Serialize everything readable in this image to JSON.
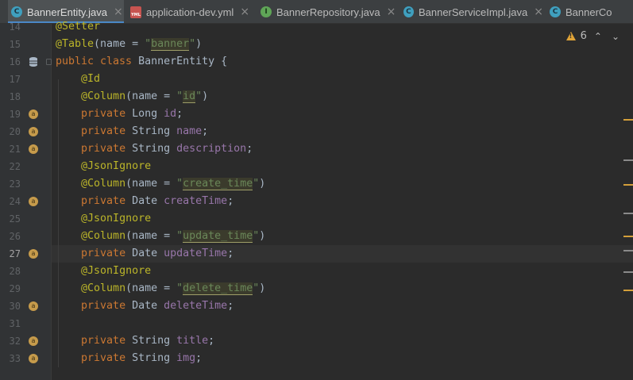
{
  "tabs": [
    {
      "label": "BannerEntity.java",
      "icon": "class-icon",
      "active": true
    },
    {
      "label": "application-dev.yml",
      "icon": "yml-icon",
      "active": false
    },
    {
      "label": "BannerRepository.java",
      "icon": "interface-icon",
      "active": false
    },
    {
      "label": "BannerServiceImpl.java",
      "icon": "class-icon",
      "active": false
    },
    {
      "label": "BannerCo",
      "icon": "class-icon",
      "active": false
    }
  ],
  "tab_close_glyph": "×",
  "inspections": {
    "warnings": "6",
    "up": "⌃",
    "down": "⌄"
  },
  "lines": [
    {
      "num": "14",
      "text": "@Setter"
    },
    {
      "num": "15",
      "text": "@Table(name = \"banner\")"
    },
    {
      "num": "16",
      "text": "public class BannerEntity {"
    },
    {
      "num": "17",
      "text": "    @Id"
    },
    {
      "num": "18",
      "text": "    @Column(name = \"id\")"
    },
    {
      "num": "19",
      "text": "    private Long id;"
    },
    {
      "num": "20",
      "text": "    private String name;"
    },
    {
      "num": "21",
      "text": "    private String description;"
    },
    {
      "num": "22",
      "text": "    @JsonIgnore"
    },
    {
      "num": "23",
      "text": "    @Column(name = \"create_time\")"
    },
    {
      "num": "24",
      "text": "    private Date createTime;"
    },
    {
      "num": "25",
      "text": "    @JsonIgnore"
    },
    {
      "num": "26",
      "text": "    @Column(name = \"update_time\")"
    },
    {
      "num": "27",
      "text": "    private Date updateTime;"
    },
    {
      "num": "28",
      "text": "    @JsonIgnore"
    },
    {
      "num": "29",
      "text": "    @Column(name = \"delete_time\")"
    },
    {
      "num": "30",
      "text": "    private Date deleteTime;"
    },
    {
      "num": "31",
      "text": ""
    },
    {
      "num": "32",
      "text": "    private String title;"
    },
    {
      "num": "33",
      "text": "    private String img;"
    }
  ],
  "colors": {
    "background": "#2b2b2b",
    "keyword": "#cc7832",
    "annotation": "#bbb529",
    "string": "#6a8759",
    "field": "#9876aa",
    "text": "#a9b7c6",
    "line_number": "#606366",
    "accent": "#4a88c7"
  }
}
